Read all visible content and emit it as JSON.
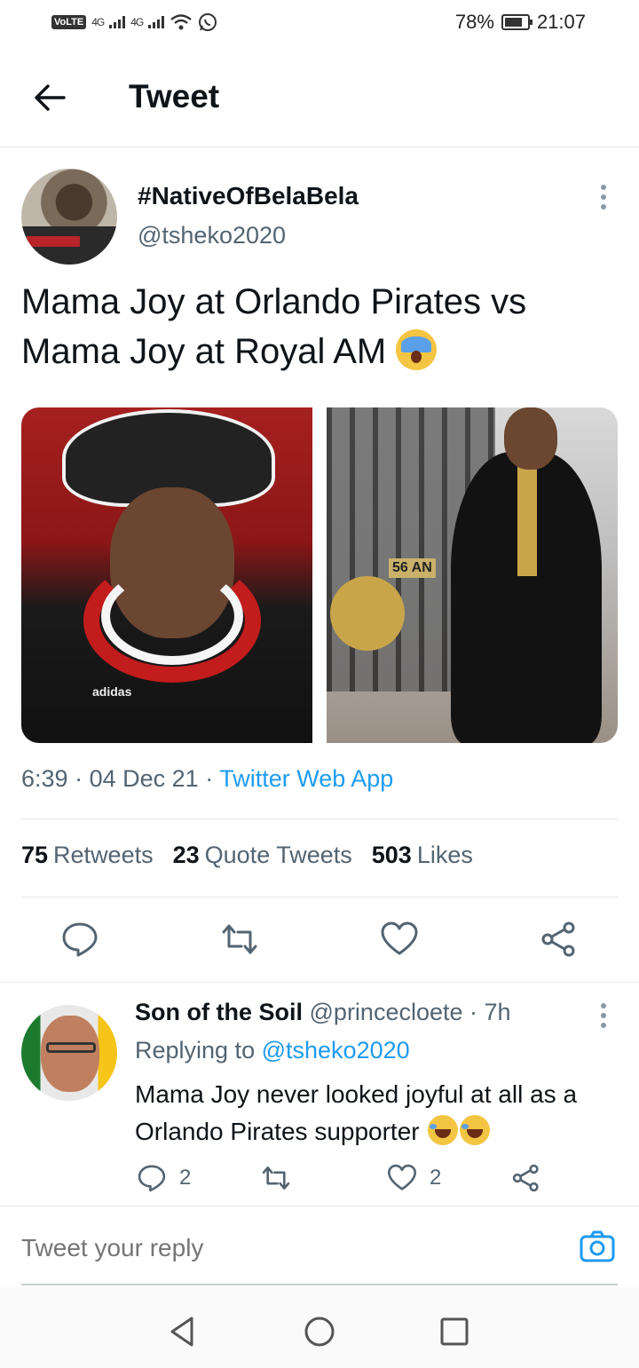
{
  "status_bar": {
    "volte": "VoLTE",
    "sim1_net": "4G",
    "sim2_net": "4G",
    "battery_percent": "78%",
    "battery_level": 0.78,
    "time": "21:07"
  },
  "header": {
    "title": "Tweet"
  },
  "tweet": {
    "author_name": "#NativeOfBelaBela",
    "author_handle": "@tsheko2020",
    "text_line1": "Mama Joy at Orlando Pirates vs",
    "text_line2": "Mama Joy at Royal AM",
    "left_photo_brand": "adidas",
    "right_photo_housenum": "56 AN",
    "time": "6:39",
    "date": "04 Dec 21",
    "source": "Twitter Web App",
    "stats": {
      "retweets_count": "75",
      "retweets_label": "Retweets",
      "quotes_count": "23",
      "quotes_label": "Quote Tweets",
      "likes_count": "503",
      "likes_label": "Likes"
    }
  },
  "reply": {
    "author_name": "Son of the Soil",
    "author_handle": "@princecloete",
    "age": "7h",
    "replying_prefix": "Replying to",
    "replying_to": "@tsheko2020",
    "text_line1": "Mama Joy never looked joyful at all as a",
    "text_line2": "Orlando Pirates supporter",
    "reply_count": "2",
    "like_count": "2"
  },
  "compose": {
    "placeholder": "Tweet your reply"
  },
  "colors": {
    "accent": "#1d9bf0",
    "text": "#0f1419",
    "secondary": "#536471",
    "divider": "#e6e9ea"
  },
  "icons": {
    "back": "back-arrow-icon",
    "more": "more-vertical-icon",
    "reply": "reply-icon",
    "retweet": "retweet-icon",
    "like": "heart-icon",
    "share": "share-icon",
    "camera": "camera-icon"
  }
}
